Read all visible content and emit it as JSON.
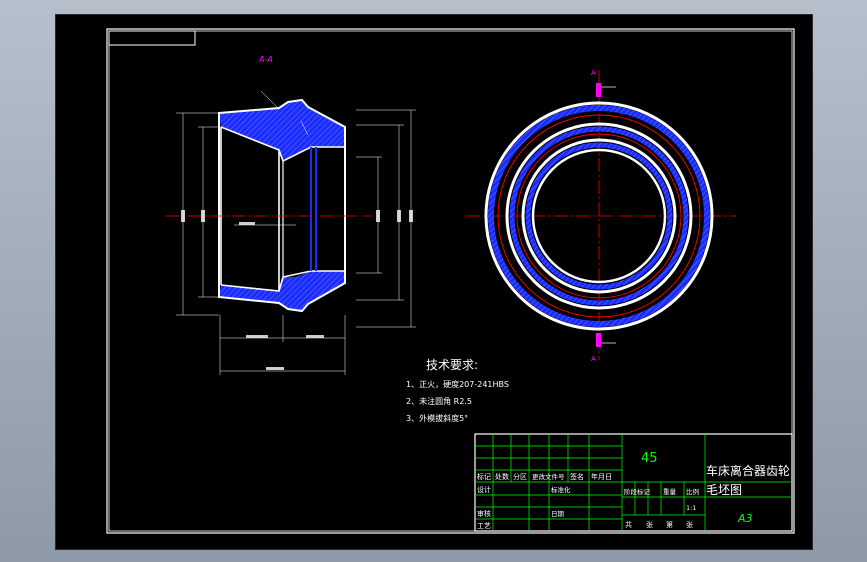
{
  "section_label": "A-A",
  "cut_marker_top": "A",
  "cut_marker_bottom": "A",
  "tech": {
    "title": "技术要求:",
    "items": [
      "1、正火，硬度207-241HBS",
      "2、未注圆角 R2.5",
      "3、外模拔斜度5°"
    ]
  },
  "title_block": {
    "material": "45",
    "part_name_line1": "车床离合器齿轮",
    "part_name_line2": "毛坯图",
    "sheet_size": "A3",
    "scale": "1:1",
    "header_labels": [
      "标记",
      "处数",
      "分区",
      "更改文件号",
      "签名",
      "年月日"
    ],
    "row_labels": [
      "设计",
      "审核",
      "工艺"
    ],
    "mid_labels": [
      "标准化",
      "日期"
    ],
    "stage_labels": [
      "阶段标记",
      "重量",
      "比例"
    ],
    "sheet_labels": [
      "共",
      "张",
      "第",
      "张"
    ]
  },
  "colors": {
    "background": "#000000",
    "outline": "#ffffff",
    "centerline": "#ff0000",
    "hatch": "#1a2cff",
    "dimension": "#ffffff",
    "annotation": "#ff00ff",
    "titleblock_grid": "#00ff00",
    "text": "#ffffff",
    "material_text": "#00ff00"
  }
}
